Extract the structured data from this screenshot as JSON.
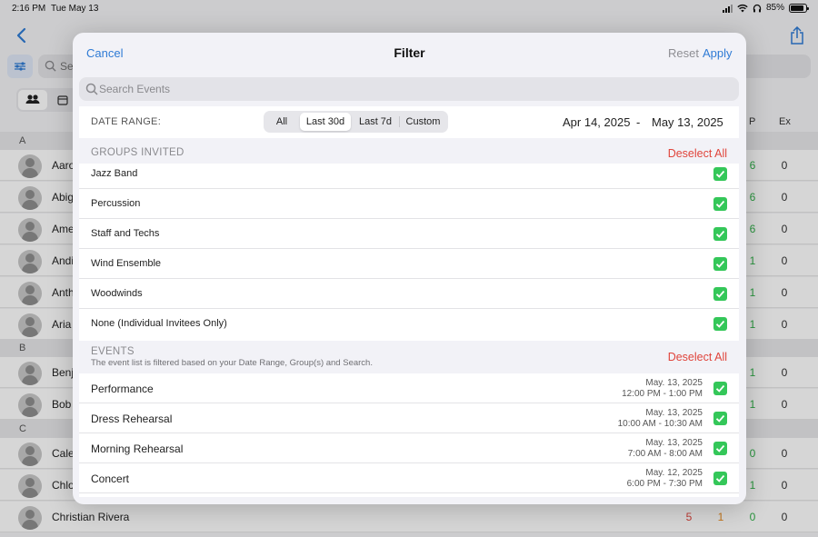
{
  "status_bar": {
    "time": "2:16 PM",
    "date": "Tue May 13",
    "battery": "85%",
    "battery_level": 0.85
  },
  "background": {
    "search_placeholder": "Se",
    "column_headers": [
      "P",
      "Ex"
    ],
    "sections": [
      {
        "letter": "A",
        "rows": [
          {
            "name": "Aaro",
            "vals": [
              "6",
              "0"
            ]
          },
          {
            "name": "Abig",
            "vals": [
              "6",
              "0"
            ]
          },
          {
            "name": "Ame",
            "vals": [
              "6",
              "0"
            ]
          },
          {
            "name": "Andi",
            "vals": [
              "1",
              "0"
            ]
          },
          {
            "name": "Anth",
            "vals": [
              "1",
              "0"
            ]
          },
          {
            "name": "Aria",
            "vals": [
              "1",
              "0"
            ]
          }
        ]
      },
      {
        "letter": "B",
        "rows": [
          {
            "name": "Benj",
            "vals": [
              "1",
              "0"
            ]
          },
          {
            "name": "Bob",
            "vals": [
              "1",
              "0"
            ]
          }
        ]
      },
      {
        "letter": "C",
        "rows": [
          {
            "name": "Cale",
            "vals": [
              "0",
              "0"
            ]
          },
          {
            "name": "Chlo",
            "vals": [
              "1",
              "0"
            ]
          },
          {
            "name": "Christian Rivera",
            "vals": [
              "5",
              "1",
              "0",
              "0"
            ]
          }
        ]
      }
    ]
  },
  "modal": {
    "cancel": "Cancel",
    "title": "Filter",
    "reset": "Reset",
    "apply": "Apply",
    "search_placeholder": "Search Events",
    "date_range": {
      "label": "DATE RANGE:",
      "options": [
        "All",
        "Last 30d",
        "Last 7d",
        "Custom"
      ],
      "selected": "Last 30d",
      "start": "Apr 14, 2025",
      "separator": "-",
      "end": "May 13, 2025"
    },
    "groups": {
      "header": "GROUPS INVITED",
      "deselect": "Deselect All",
      "items": [
        {
          "label": "Jazz Band",
          "checked": true
        },
        {
          "label": "Percussion",
          "checked": true
        },
        {
          "label": "Staff and Techs",
          "checked": true
        },
        {
          "label": "Wind Ensemble",
          "checked": true
        },
        {
          "label": "Woodwinds",
          "checked": true
        },
        {
          "label": "None (Individual Invitees Only)",
          "checked": true
        }
      ]
    },
    "events": {
      "header": "EVENTS",
      "subtitle": "The event list is filtered based on your Date Range, Group(s) and Search.",
      "deselect": "Deselect All",
      "items": [
        {
          "label": "Performance",
          "date": "May. 13, 2025",
          "time": "12:00 PM - 1:00 PM",
          "checked": true
        },
        {
          "label": "Dress Rehearsal",
          "date": "May. 13, 2025",
          "time": "10:00 AM - 10:30 AM",
          "checked": true
        },
        {
          "label": "Morning Rehearsal",
          "date": "May. 13, 2025",
          "time": "7:00 AM - 8:00 AM",
          "checked": true
        },
        {
          "label": "Concert",
          "date": "May. 12, 2025",
          "time": "6:00 PM - 7:30 PM",
          "checked": true
        }
      ]
    }
  },
  "colors": {
    "accent": "#2f7bd5",
    "destructive": "#e0453c",
    "check": "#34c759"
  }
}
